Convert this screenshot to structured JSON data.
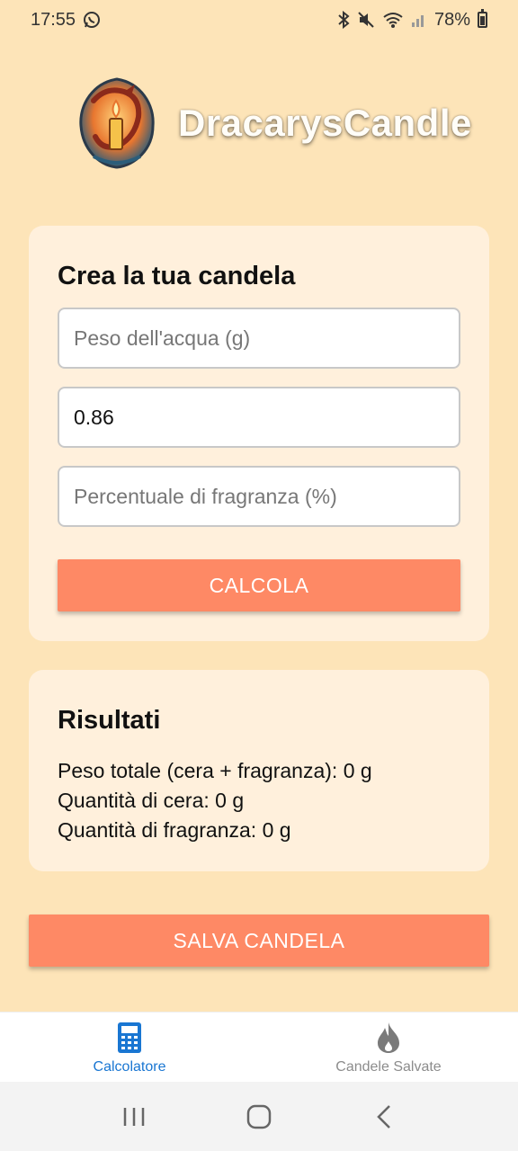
{
  "status_bar": {
    "time": "17:55",
    "battery": "78%",
    "icons": [
      "whatsapp-icon",
      "bluetooth-icon",
      "mute-icon",
      "wifi-icon",
      "signal-icon",
      "battery-icon"
    ]
  },
  "header": {
    "title": "DracarysCandle",
    "logo": "dragon-candle-logo"
  },
  "form": {
    "title": "Crea la tua candela",
    "water_weight": {
      "value": "",
      "placeholder": "Peso dell'acqua (g)"
    },
    "ratio": {
      "value": "0.86",
      "placeholder": ""
    },
    "fragrance_percent": {
      "value": "",
      "placeholder": "Percentuale di fragranza (%)"
    },
    "calculate_label": "CALCOLA"
  },
  "results": {
    "title": "Risultati",
    "total_weight": "Peso totale (cera + fragranza): 0 g",
    "wax_quantity": "Quantità di cera: 0 g",
    "fragrance_quantity": "Quantità di fragranza: 0 g"
  },
  "save_label": "SALVA CANDELA",
  "bottom_nav": {
    "items": [
      {
        "label": "Calcolatore",
        "icon": "calculator-icon",
        "active": true
      },
      {
        "label": "Candele Salvate",
        "icon": "flame-icon",
        "active": false
      }
    ]
  },
  "colors": {
    "background": "#fde4b8",
    "card": "#fff0dc",
    "button": "#fe8965",
    "active_nav": "#1976d2"
  }
}
